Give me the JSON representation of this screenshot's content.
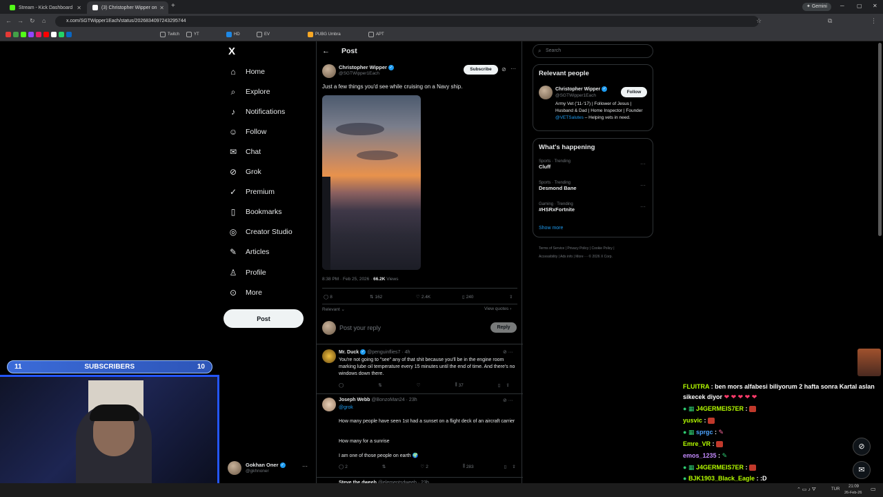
{
  "browser": {
    "tabs": [
      {
        "label": "Stream - Kick Dashboard"
      },
      {
        "label": "(3) Christopher Wipper on"
      }
    ],
    "gemini_label": "Gemini",
    "url": "x.com/SGTWipper1Each/status/2026834097243295744",
    "bookmarks": [
      "Twitch",
      "YT",
      "HD",
      "EV",
      "PUBG Umbra",
      "APT"
    ]
  },
  "nav": {
    "logo": "X",
    "items": [
      "Home",
      "Explore",
      "Notifications",
      "Follow",
      "Chat",
      "Grok",
      "Premium",
      "Bookmarks",
      "Creator Studio",
      "Articles",
      "Profile",
      "More"
    ],
    "post_button": "Post",
    "account": {
      "name": "Gokhan Oner",
      "handle": "@gkhnoner"
    }
  },
  "post": {
    "header": "Post",
    "author": "Christopher Wipper",
    "handle": "@SGTWipper1Each",
    "subscribe": "Subscribe",
    "text": "Just a few things you'd see while cruising on a Navy ship.",
    "timestamp": "8:38 PM · Feb 25, 2026 · ",
    "views_count": "66.2K",
    "views_label": " Views",
    "replies": "8",
    "reposts": "162",
    "likes": "2.4K",
    "bookmarks": "240",
    "sort": "Relevant",
    "view_quotes": "View quotes",
    "reply_placeholder": "Post your reply",
    "reply_button": "Reply"
  },
  "replies": [
    {
      "name": "Mr. Duck",
      "handle": "@penguinflies7 · 4h",
      "text": "You're not going to \"see\" any of that shit because you'll be in the engine room marking lube oil temperature every 15 minutes until the end of time. And there's no windows down there.",
      "views": "37"
    },
    {
      "name": "Joseph Webb",
      "handle": "@BonzoMan24 · 23h",
      "mention": "@grok",
      "line1": "How many people have seen 1st had a sunset on a flight deck of an aircraft carrier",
      "line2": "How many for a sunrise",
      "line3": "I am one of those people on earth",
      "replies": "2",
      "likes": "2",
      "views": "283"
    },
    {
      "name": "Steve the dweeb",
      "handle": "@elementsdweeb · 23h"
    }
  ],
  "search": {
    "placeholder": "Search"
  },
  "relevant": {
    "title": "Relevant people",
    "name": "Christopher Wipper",
    "handle": "@SGTWipper1Each",
    "follow": "Follow",
    "bio": "Army Vet ('11-'17) | Follower of Jesus | Husband & Dad | Home Inspector | Founder ",
    "bio_link": "@VETSalutes",
    "bio_end": " – Helping vets in need."
  },
  "happening": {
    "title": "What's happening",
    "trends": [
      {
        "category": "Sports · Trending",
        "name": "Cluff"
      },
      {
        "category": "Sports · Trending",
        "name": "Desmond Bane"
      },
      {
        "category": "Gaming · Trending",
        "name": "#HSRxFortnite"
      }
    ],
    "show_more": "Show more"
  },
  "footer_links": [
    "Terms of Service",
    "Privacy Policy",
    "Cookie Policy",
    "Accessibility",
    "Ads info",
    "More ···",
    "© 2026 X Corp."
  ],
  "overlay": {
    "subs_left": "11",
    "subs_label": "SUBSCRIBERS",
    "subs_right": "10",
    "chat": [
      {
        "user": "FLUITRA",
        "msg": " : ben mors alfabesi biliyorum 2 hafta sonra Kartal aslan",
        "color": "#b6ff00"
      },
      {
        "user": "",
        "msg": "sikecek diyor",
        "color": "#ffffff"
      },
      {
        "user": "J4GERMEIS7ER",
        "msg": " :",
        "color": "#b6ff00"
      },
      {
        "user": "yusvic",
        "msg": " :",
        "color": "#b6ff00"
      },
      {
        "user": "sprgc",
        "msg": " :",
        "color": "#4da3ff"
      },
      {
        "user": "Emre_VR",
        "msg": " :",
        "color": "#b6ff00"
      },
      {
        "user": "emos_1235",
        "msg": " :",
        "color": "#c58bff"
      },
      {
        "user": "J4GERMEIS7ER",
        "msg": " :",
        "color": "#b6ff00"
      },
      {
        "user": "BJK1903_Black_Eagle",
        "msg": " : :D",
        "color": "#b6ff00"
      }
    ]
  },
  "taskbar": {
    "lang": "TUR",
    "time": "21:09",
    "date": "26-Feb-26"
  }
}
